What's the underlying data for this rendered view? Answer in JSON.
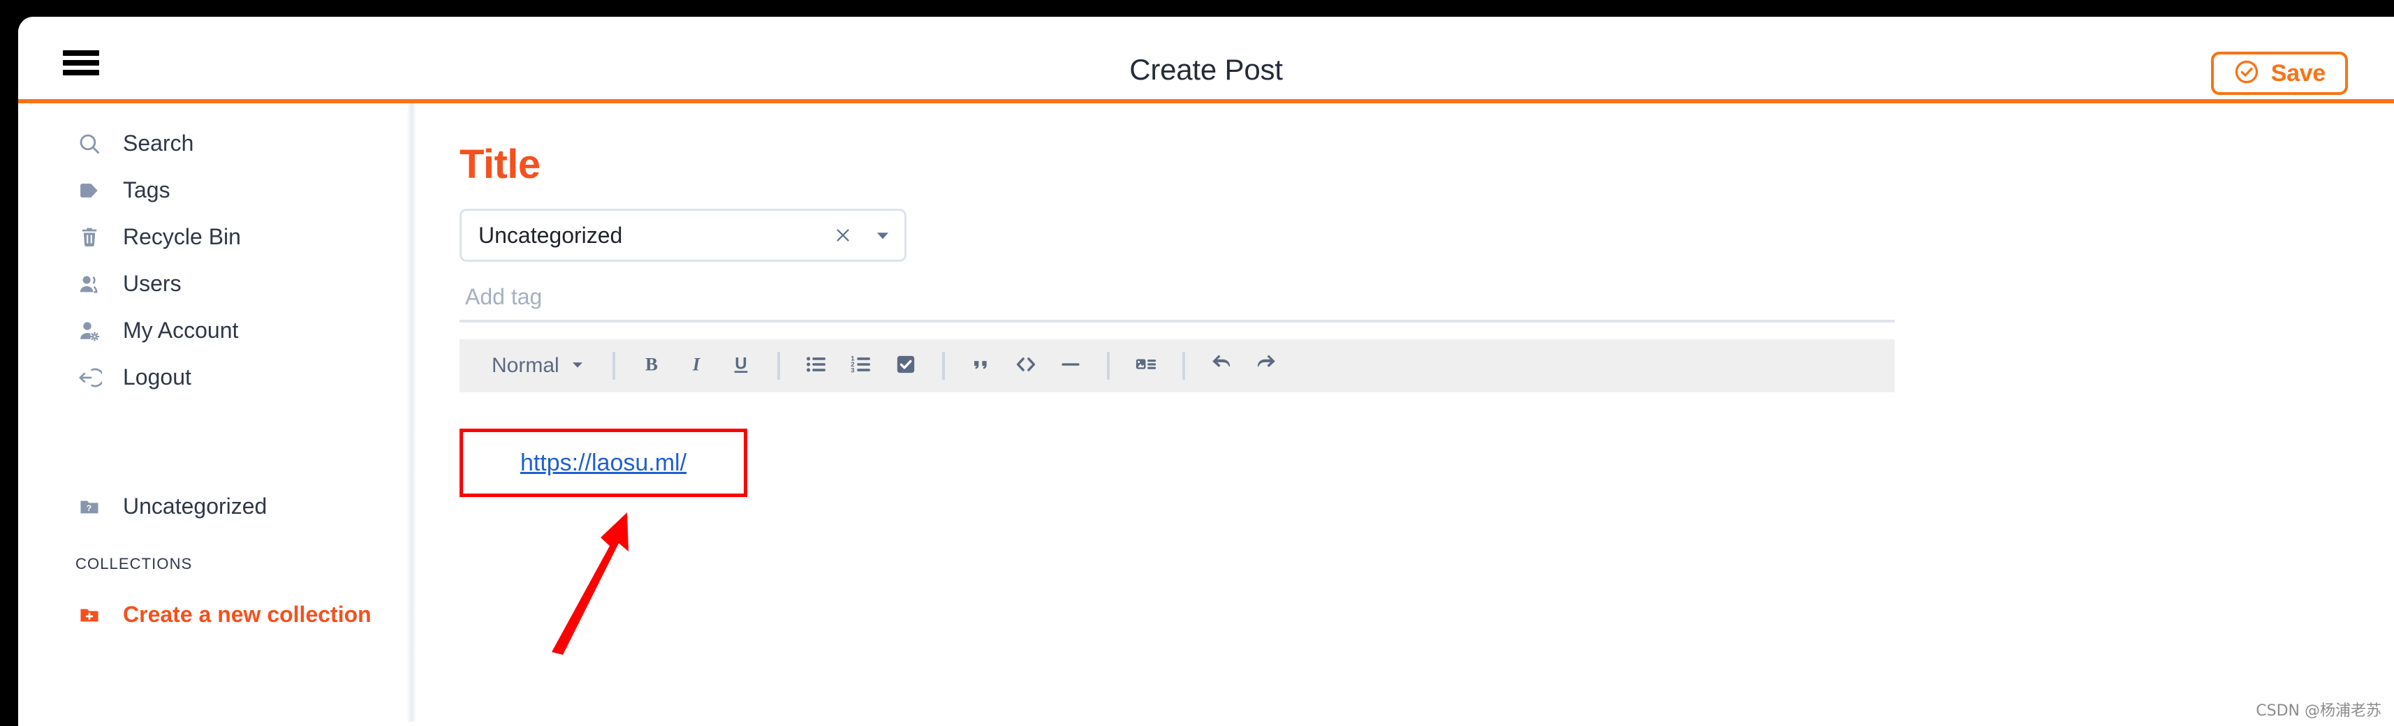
{
  "header": {
    "menu_icon": "hamburger-menu-icon",
    "title": "Create Post",
    "save_label": "Save",
    "save_icon": "check-circle-icon",
    "accent_color": "#f97316",
    "title_color": "#252b3a"
  },
  "sidebar": {
    "items": [
      {
        "label": "Search",
        "icon": "search-icon"
      },
      {
        "label": "Tags",
        "icon": "tag-icon"
      },
      {
        "label": "Recycle Bin",
        "icon": "trash-icon"
      },
      {
        "label": "Users",
        "icon": "users-icon"
      },
      {
        "label": "My Account",
        "icon": "user-gear-icon"
      },
      {
        "label": "Logout",
        "icon": "logout-arrow-icon"
      }
    ],
    "uncategorized": {
      "label": "Uncategorized",
      "icon": "folder-question-icon"
    },
    "collections_heading": "COLLECTIONS",
    "create_collection": {
      "label": "Create a new collection",
      "icon": "folder-plus-icon",
      "color": "#f4511e"
    },
    "icon_color": "#8896ad",
    "label_color": "#2f3747"
  },
  "editor": {
    "title_placeholder": "Title",
    "title_value": "",
    "title_color": "#f4511e",
    "category": {
      "value": "Uncategorized",
      "clear_icon": "close-icon",
      "caret_icon": "chevron-down-icon"
    },
    "tag": {
      "placeholder": "Add tag",
      "value": ""
    },
    "toolbar": {
      "block_format": "Normal",
      "block_caret_icon": "chevron-down-icon",
      "buttons": [
        {
          "name": "bold-button",
          "icon": "bold-icon"
        },
        {
          "name": "italic-button",
          "icon": "italic-icon"
        },
        {
          "name": "underline-button",
          "icon": "underline-icon"
        },
        {
          "name": "bullet-list-button",
          "icon": "bullet-list-icon"
        },
        {
          "name": "numbered-list-button",
          "icon": "numbered-list-icon"
        },
        {
          "name": "checklist-button",
          "icon": "checkbox-checked-icon"
        },
        {
          "name": "blockquote-button",
          "icon": "quote-icon"
        },
        {
          "name": "code-button",
          "icon": "code-brackets-icon"
        },
        {
          "name": "horizontal-rule-button",
          "icon": "horizontal-rule-icon"
        },
        {
          "name": "media-button",
          "icon": "image-text-icon"
        },
        {
          "name": "undo-button",
          "icon": "undo-arrow-icon"
        },
        {
          "name": "redo-button",
          "icon": "redo-arrow-icon"
        }
      ],
      "background": "#efefef",
      "icon_color": "#5b6a82"
    },
    "content_link": {
      "text": "https://laosu.ml/",
      "color": "#1f5fd0"
    }
  },
  "annotations": {
    "highlight_color": "#ff0000",
    "box_target": "content-link",
    "arrow": "red-arrow-pointing-up-right"
  },
  "watermark": {
    "text": "CSDN @杨浦老苏"
  }
}
